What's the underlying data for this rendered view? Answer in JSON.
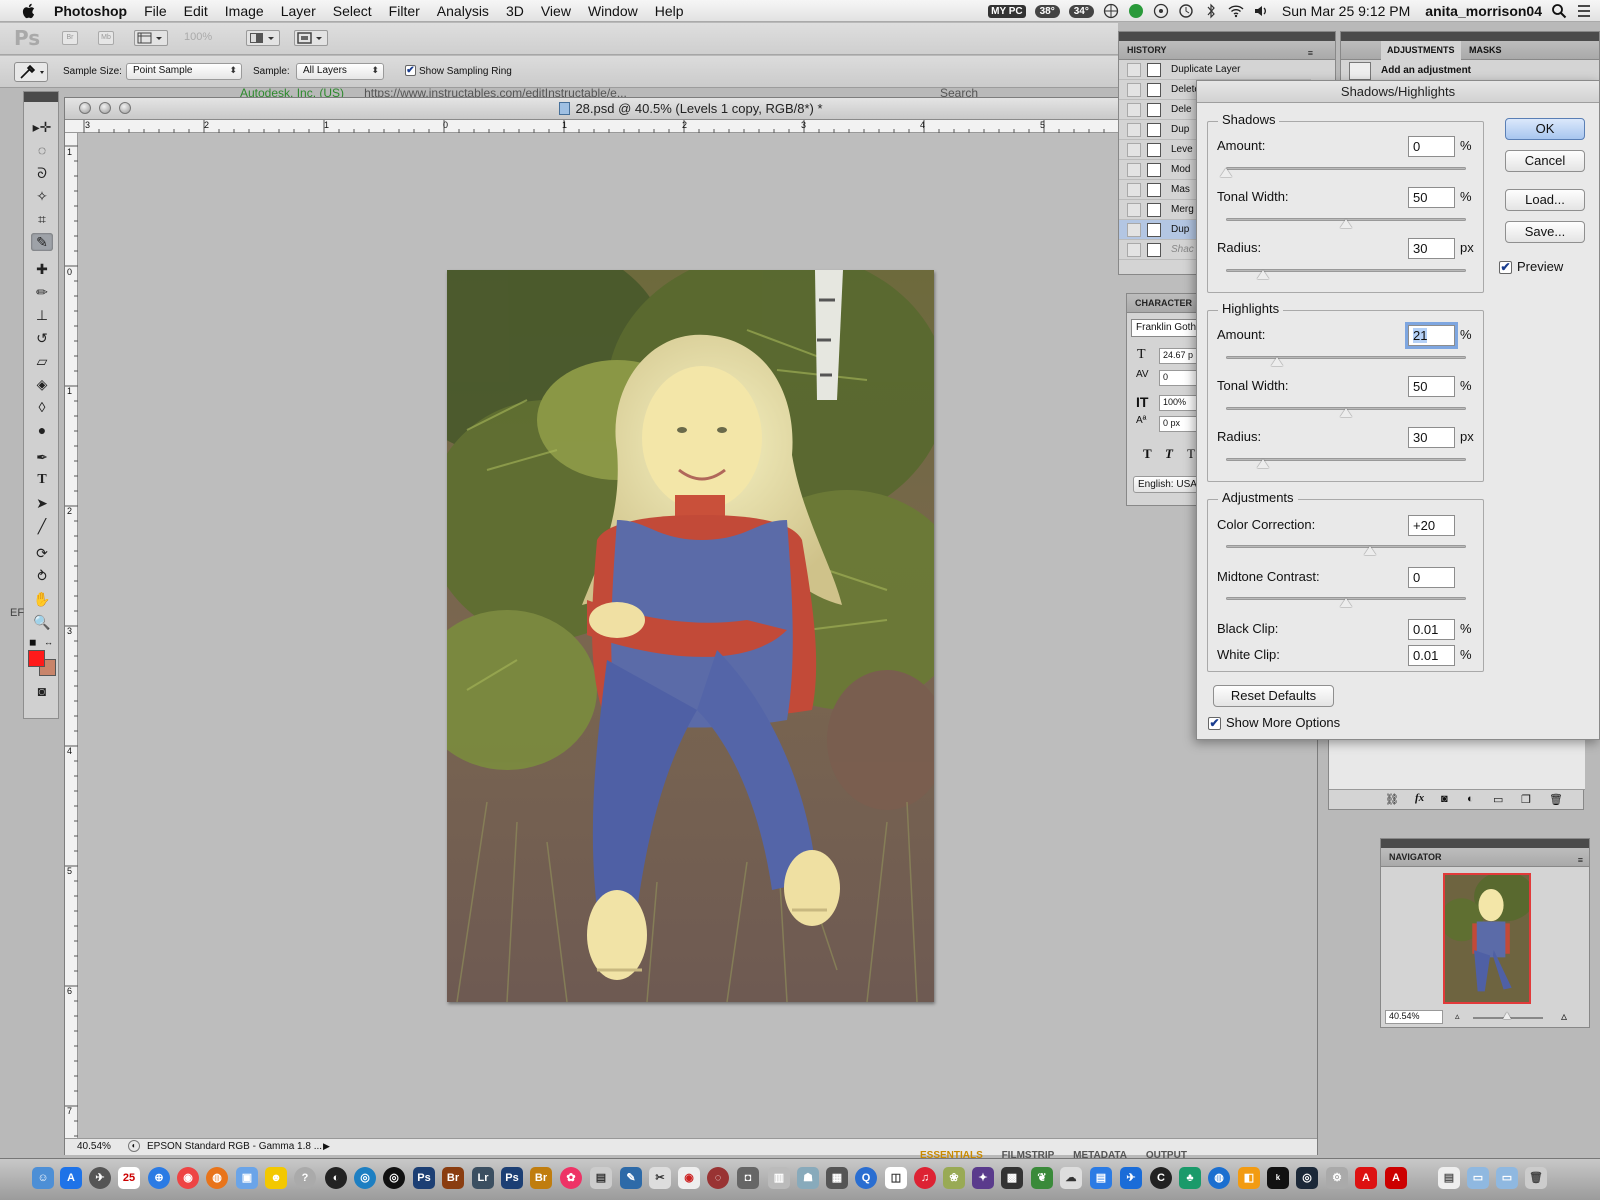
{
  "menubar": {
    "app_name": "Photoshop",
    "items": [
      "File",
      "Edit",
      "Image",
      "Layer",
      "Select",
      "Filter",
      "Analysis",
      "3D",
      "View",
      "Window",
      "Help"
    ],
    "status": {
      "badge": "MY PC",
      "temp1": "38°",
      "temp2": "34°",
      "datetime": "Sun Mar 25  9:12 PM",
      "user": "anita_morrison04"
    }
  },
  "appbar": {
    "logo": "Ps",
    "br": "Br",
    "mb": "Mb",
    "zoom": "100%"
  },
  "options": {
    "sample_size_label": "Sample Size:",
    "sample_size_value": "Point Sample",
    "sample_label": "Sample:",
    "sample_value": "All Layers",
    "sampling_ring_label": "Show Sampling Ring",
    "sampling_ring_checked": true
  },
  "background_browser": {
    "site": "Autodesk, Inc. (US)",
    "url": "https://www.instructables.com/editInstructable/e...",
    "search": "Search"
  },
  "document": {
    "title": "28.psd @ 40.5% (Levels 1 copy, RGB/8*) *",
    "ruler_top": [
      "3",
      "2",
      "1",
      "0",
      "1",
      "2",
      "3",
      "4",
      "5"
    ],
    "ruler_left": [
      "1",
      "0",
      "1",
      "2",
      "3",
      "4",
      "5",
      "6",
      "7"
    ],
    "status_zoom": "40.54%",
    "status_profile": "EPSON  Standard RGB - Gamma 1.8 ..."
  },
  "history": {
    "title": "HISTORY",
    "items": [
      {
        "label": "Duplicate Layer",
        "selected": false
      },
      {
        "label": "Delete Layer",
        "selected": false
      },
      {
        "label": "Dele",
        "selected": false
      },
      {
        "label": "Dup",
        "selected": false
      },
      {
        "label": "Leve",
        "selected": false
      },
      {
        "label": "Mod",
        "selected": false
      },
      {
        "label": "Mas",
        "selected": false
      },
      {
        "label": "Merg",
        "selected": false
      },
      {
        "label": "Dup",
        "selected": true
      },
      {
        "label": "Shac",
        "selected": false
      }
    ]
  },
  "adjustments": {
    "tab1": "ADJUSTMENTS",
    "tab2": "MASKS",
    "hint": "Add an adjustment"
  },
  "character": {
    "title": "CHARACTER",
    "font": "Franklin Goth",
    "size": "24.67 p",
    "tracking": "0",
    "vscale": "100%",
    "baseline": "0 px",
    "language": "English: USA"
  },
  "navigator": {
    "title": "NAVIGATOR",
    "zoom": "40.54%"
  },
  "dialog": {
    "title": "Shadows/Highlights",
    "shadows": {
      "legend": "Shadows",
      "amount_label": "Amount:",
      "amount": "0",
      "amount_unit": "%",
      "tonal_label": "Tonal Width:",
      "tonal": "50",
      "tonal_unit": "%",
      "radius_label": "Radius:",
      "radius": "30",
      "radius_unit": "px"
    },
    "highlights": {
      "legend": "Highlights",
      "amount_label": "Amount:",
      "amount": "21",
      "amount_unit": "%",
      "tonal_label": "Tonal Width:",
      "tonal": "50",
      "tonal_unit": "%",
      "radius_label": "Radius:",
      "radius": "30",
      "radius_unit": "px"
    },
    "adjustments": {
      "legend": "Adjustments",
      "color_label": "Color Correction:",
      "color": "+20",
      "midtone_label": "Midtone Contrast:",
      "midtone": "0",
      "black_label": "Black Clip:",
      "black": "0.01",
      "black_unit": "%",
      "white_label": "White Clip:",
      "white": "0.01",
      "white_unit": "%"
    },
    "reset_label": "Reset Defaults",
    "more_options_label": "Show More Options",
    "more_options_checked": true,
    "ok_label": "OK",
    "cancel_label": "Cancel",
    "load_label": "Load...",
    "save_label": "Save...",
    "preview_label": "Preview",
    "preview_checked": true
  },
  "bridge_tabs": [
    "ESSENTIALS",
    "FILMSTRIP",
    "METADATA",
    "OUTPUT"
  ],
  "dock": {
    "calendar_day": "25"
  },
  "colors": {
    "foreground": "#ff1a1a",
    "background": "#c8846a",
    "selection": "#b3c6e3",
    "default_button": "#a8c6ef"
  }
}
